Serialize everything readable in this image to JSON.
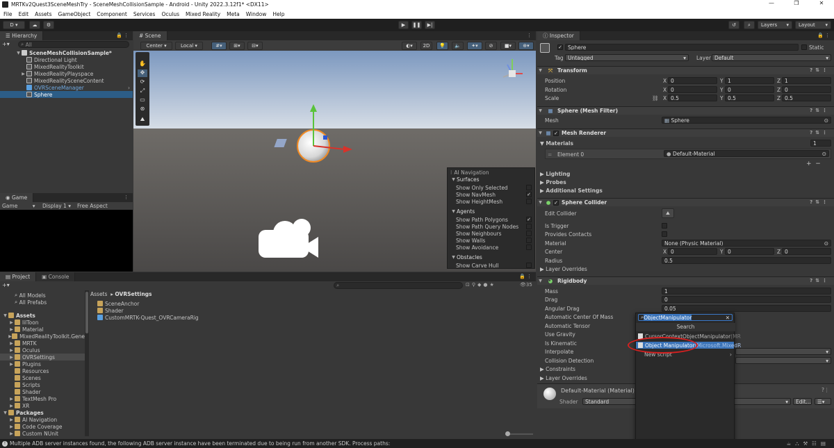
{
  "window": {
    "title": "MRTKv2Quest3SceneMeshTry - SceneMeshCollisionSample - Android - Unity 2022.3.12f1* <DX11>",
    "minimize": "—",
    "restore": "❐",
    "close": "✕"
  },
  "menu": [
    "File",
    "Edit",
    "Assets",
    "GameObject",
    "Component",
    "Services",
    "Oculus",
    "Mixed Reality",
    "Meta",
    "Window",
    "Help"
  ],
  "toolbar": {
    "account": "D",
    "layers": "Layers",
    "layout": "Layout"
  },
  "hierarchy": {
    "tab": "Hierarchy",
    "search_placeholder": "All",
    "scene": "SceneMeshCollisionSample*",
    "items": [
      "Directional Light",
      "MixedRealityToolkit",
      "MixedRealityPlayspace",
      "MixedRealitySceneContent",
      "OVRSceneManager",
      "Sphere"
    ]
  },
  "scene": {
    "tab": "Scene",
    "pivot": "Center",
    "space": "Local",
    "mode2d": "2D"
  },
  "overlay": {
    "title": "AI Navigation",
    "sections": [
      {
        "name": "Surfaces",
        "items": [
          {
            "label": "Show Only Selected",
            "checked": false
          },
          {
            "label": "Show NavMesh",
            "checked": true
          },
          {
            "label": "Show HeightMesh",
            "checked": false
          }
        ]
      },
      {
        "name": "Agents",
        "items": [
          {
            "label": "Show Path Polygons",
            "checked": true
          },
          {
            "label": "Show Path Query Nodes",
            "checked": false
          },
          {
            "label": "Show Neighbours",
            "checked": false
          },
          {
            "label": "Show Walls",
            "checked": false
          },
          {
            "label": "Show Avoidance",
            "checked": false
          }
        ]
      },
      {
        "name": "Obstacles",
        "items": [
          {
            "label": "Show Carve Hull",
            "checked": false
          }
        ]
      }
    ]
  },
  "game": {
    "tab": "Game",
    "mode": "Game",
    "display": "Display 1",
    "aspect": "Free Aspect"
  },
  "project": {
    "tabs": [
      "Project",
      "Console"
    ],
    "favorites": [
      "All Models",
      "All Prefabs"
    ],
    "assets_root": "Assets",
    "assets": [
      "lilToon",
      "Material",
      "MixedRealityToolkit.Gene",
      "MRTK",
      "Oculus",
      "OVRSettings",
      "Plugins",
      "Resources",
      "Scenes",
      "Scripts",
      "Shader",
      "TextMesh Pro",
      "XR"
    ],
    "packages_root": "Packages",
    "packages": [
      "AI Navigation",
      "Code Coverage",
      "Custom NUnit"
    ],
    "breadcrumb": [
      "Assets",
      "OVRSettings"
    ],
    "files": [
      {
        "name": "SceneAnchor",
        "kind": "folder"
      },
      {
        "name": "Shader",
        "kind": "folder"
      },
      {
        "name": "CustomMRTK-Quest_OVRCameraRig",
        "kind": "prefab"
      }
    ],
    "count": "35"
  },
  "inspector": {
    "tab": "Inspector",
    "object_name": "Sphere",
    "static": "Static",
    "tag_label": "Tag",
    "tag": "Untagged",
    "layer_label": "Layer",
    "layer": "Default",
    "transform": {
      "title": "Transform",
      "position": {
        "label": "Position",
        "x": "0",
        "y": "1",
        "z": "1"
      },
      "rotation": {
        "label": "Rotation",
        "x": "0",
        "y": "0",
        "z": "0"
      },
      "scale": {
        "label": "Scale",
        "x": "0.5",
        "y": "0.5",
        "z": "0.5"
      }
    },
    "mesh_filter": {
      "title": "Sphere (Mesh Filter)",
      "mesh_label": "Mesh",
      "mesh": "Sphere"
    },
    "mesh_renderer": {
      "title": "Mesh Renderer",
      "materials_label": "Materials",
      "materials_count": "1",
      "element_label": "Element 0",
      "element": "Default-Material",
      "lighting": "Lighting",
      "probes": "Probes",
      "additional": "Additional Settings"
    },
    "collider": {
      "title": "Sphere Collider",
      "edit": "Edit Collider",
      "is_trigger": "Is Trigger",
      "provides_contacts": "Provides Contacts",
      "material_label": "Material",
      "material": "None (Physic Material)",
      "center_label": "Center",
      "cx": "0",
      "cy": "0",
      "cz": "0",
      "radius_label": "Radius",
      "radius": "0.5",
      "layer_overrides": "Layer Overrides"
    },
    "rigidbody": {
      "title": "Rigidbody",
      "labels": [
        "Mass",
        "Drag",
        "Angular Drag",
        "Automatic Center Of Mass",
        "Automatic Tensor",
        "Use Gravity",
        "Is Kinematic",
        "Interpolate",
        "Collision Detection",
        "Constraints",
        "Layer Overrides"
      ],
      "mass": "1",
      "drag": "0",
      "angular_drag": "0.05"
    },
    "material": {
      "name": "Default-Material (Material)",
      "shader_label": "Shader",
      "shader": "Standard",
      "edit": "Edit..."
    }
  },
  "popup": {
    "search_value": "ObjectManipulator",
    "header": "Search",
    "results": [
      {
        "name": "CursorContextObjectManipulator",
        "ns": "(MR"
      },
      {
        "name": "Object Manipulator",
        "ns": "(Microsoft.MixedR"
      }
    ],
    "new_script": "New script"
  },
  "status": "Multiple ADB server instances found, the following ADB server instance have been terminated due to being run from another SDK. Process paths:",
  "colors": {
    "accent": "#2c5d87",
    "highlight_circle": "#d62020",
    "selection": "#3a73b8"
  }
}
